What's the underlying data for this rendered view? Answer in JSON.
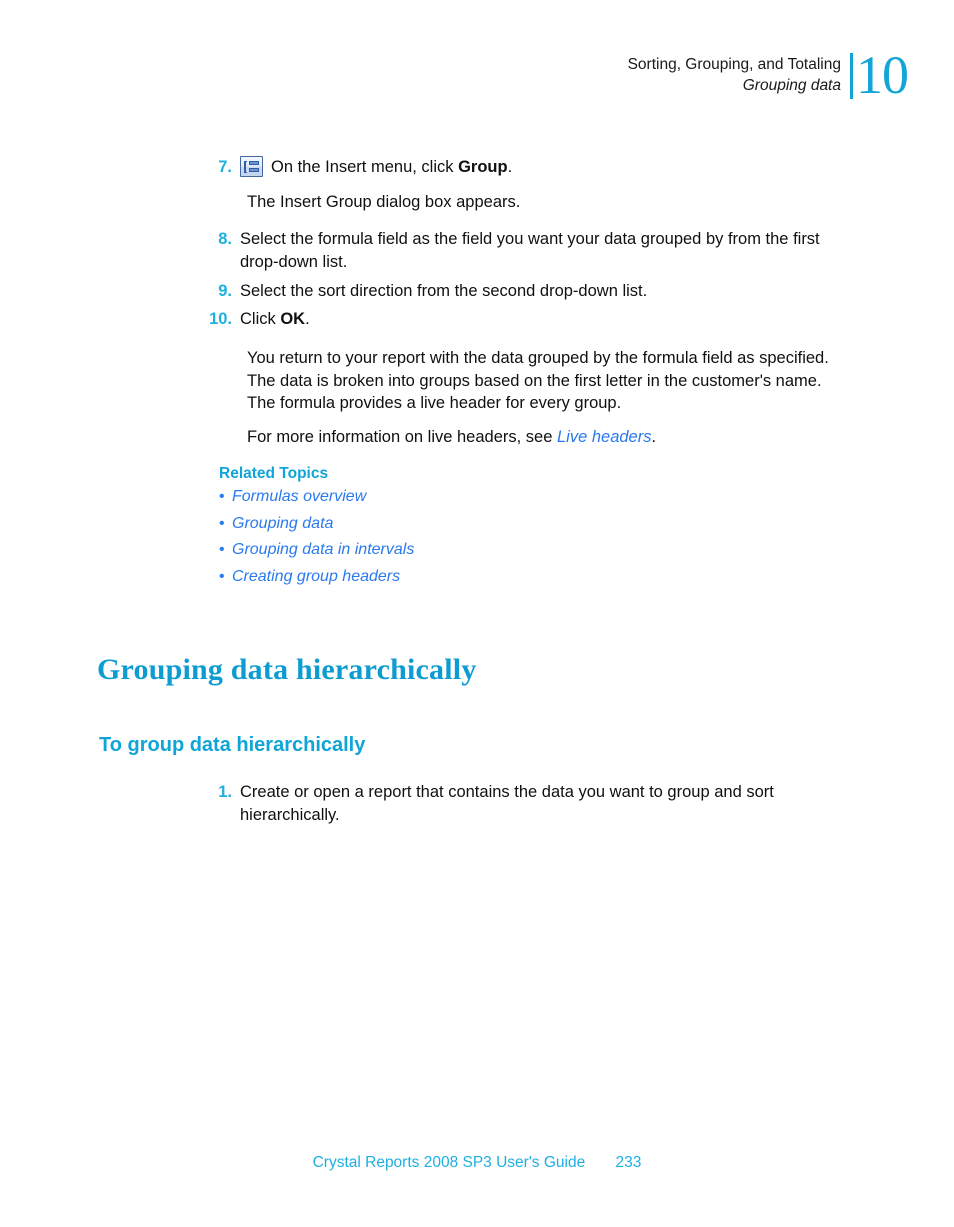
{
  "header": {
    "line1": "Sorting, Grouping, and Totaling",
    "line2": "Grouping data",
    "chapter_number": "10",
    "accent_color": "#14a5d8"
  },
  "steps_group_a": [
    {
      "number": "7.",
      "icon": "insert-group-icon",
      "text_before": "On the Insert menu, click ",
      "bold": "Group",
      "text_after": "."
    },
    {
      "number": "8.",
      "text": "Select the formula field as the field you want your data grouped by from the first drop-down list."
    },
    {
      "number": "9.",
      "text": "Select the sort direction from the second drop-down list."
    },
    {
      "number": "10.",
      "text_before": "Click ",
      "bold": "OK",
      "text_after": "."
    }
  ],
  "paragraphs": {
    "after_step7": "The Insert Group dialog box appears.",
    "result": "You return to your report with the data grouped by the formula field as specified. The data is broken into groups based on the first letter in the customer's name. The formula provides a live header for every group.",
    "more_info_before": "For more information on live headers, see ",
    "more_info_link": "Live headers",
    "more_info_after": "."
  },
  "related": {
    "title": "Related Topics",
    "bullet": "•",
    "items": [
      "Formulas overview",
      "Grouping data",
      "Grouping data in intervals",
      "Creating group headers"
    ]
  },
  "section": {
    "title": "Grouping data hierarchically",
    "subtitle": "To group data hierarchically"
  },
  "steps_group_b": [
    {
      "number": "1.",
      "text": "Create or open a report that contains the data you want to group and sort hierarchically."
    }
  ],
  "footer": {
    "guide": "Crystal Reports 2008 SP3 User's Guide",
    "page": "233"
  },
  "colors": {
    "heading_cyan": "#0c9cd2",
    "accent_cyan": "#1eafe2",
    "link_blue": "#2a79ee",
    "body_black": "#101010"
  }
}
